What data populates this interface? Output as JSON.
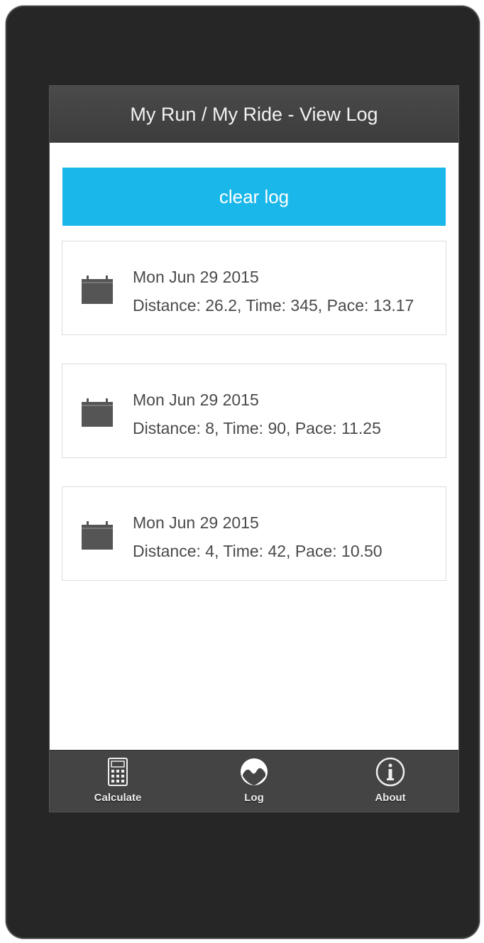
{
  "header": {
    "title": "My Run / My Ride - View Log"
  },
  "actions": {
    "clear_label": "clear log"
  },
  "log": {
    "entries": [
      {
        "date": "Mon Jun 29 2015",
        "summary": "Distance: 26.2, Time: 345, Pace: 13.17"
      },
      {
        "date": "Mon Jun 29 2015",
        "summary": "Distance: 8, Time: 90, Pace: 11.25"
      },
      {
        "date": "Mon Jun 29 2015",
        "summary": "Distance: 4, Time: 42, Pace: 10.50"
      }
    ]
  },
  "tabbar": {
    "tabs": [
      {
        "label": "Calculate",
        "icon": "calculator-icon"
      },
      {
        "label": "Log",
        "icon": "log-icon"
      },
      {
        "label": "About",
        "icon": "info-icon"
      }
    ]
  },
  "colors": {
    "accent": "#1ab7ea",
    "header_bg": "#444444",
    "frame": "#262626"
  }
}
